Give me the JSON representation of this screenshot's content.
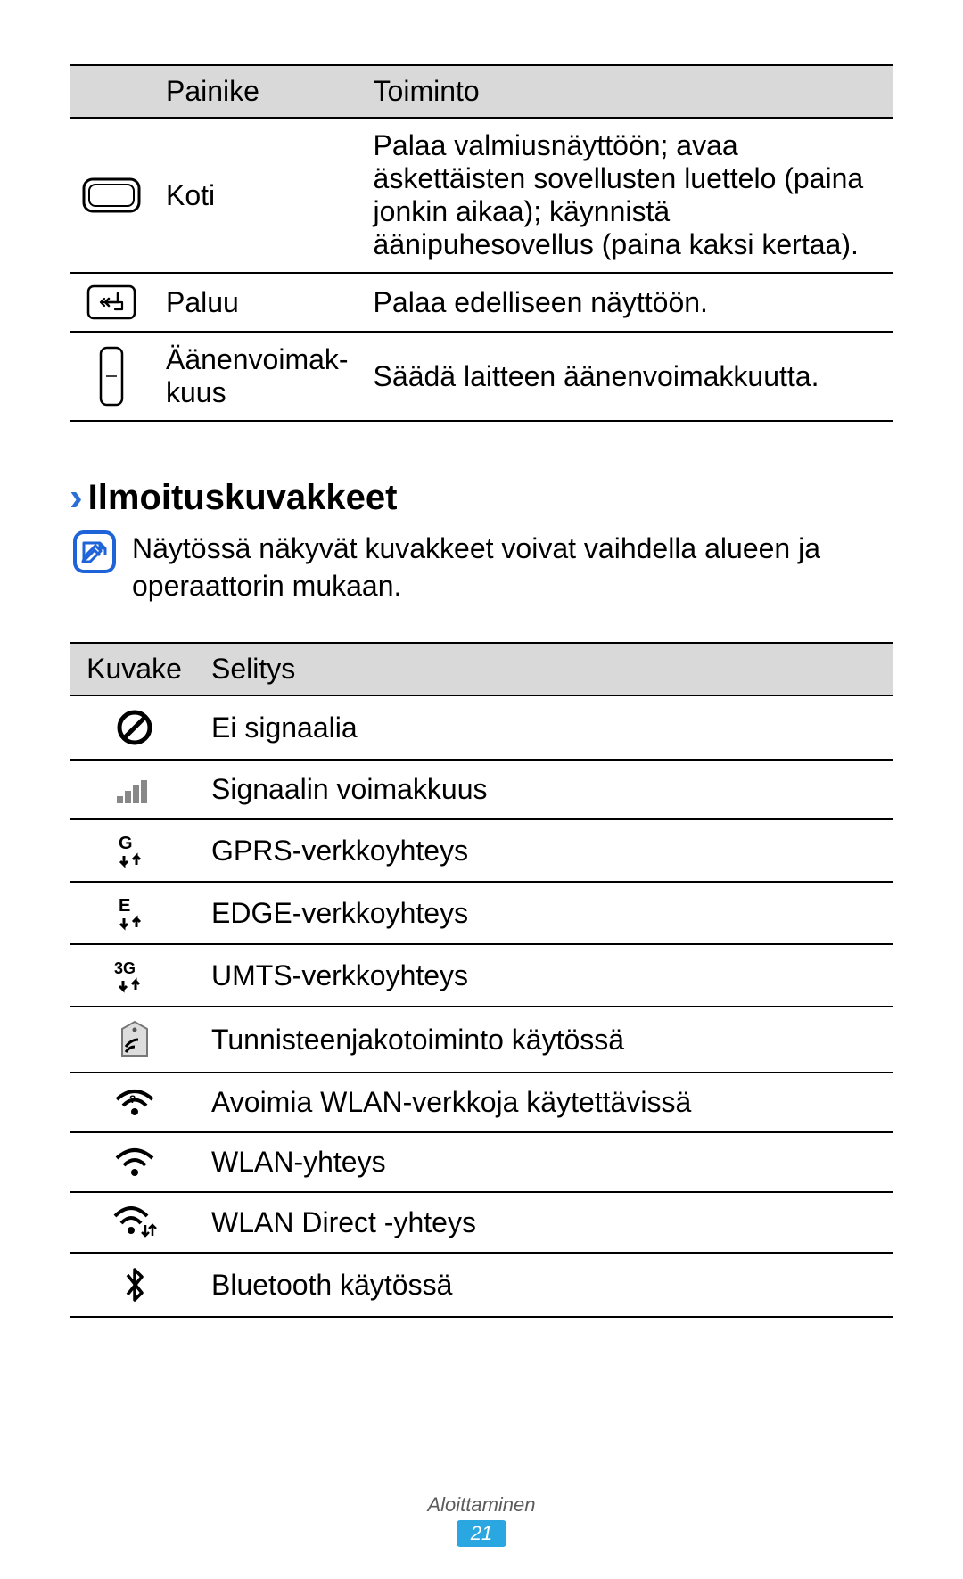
{
  "table1": {
    "headers": {
      "button": "Painike",
      "function": "Toiminto"
    },
    "rows": [
      {
        "name": "Koti",
        "func": "Palaa valmiusnäyttöön; avaa äskettäisten sovellusten luettelo (paina jonkin aikaa); käynnistä äänipuhesovellus (paina kaksi kertaa)."
      },
      {
        "name": "Paluu",
        "func": "Palaa edelliseen näyttöön."
      },
      {
        "name": "Äänenvoimak-kuus",
        "func": "Säädä laitteen äänenvoimakkuutta."
      }
    ]
  },
  "section": {
    "title": "Ilmoituskuvakkeet",
    "note": "Näytössä näkyvät kuvakkeet voivat vaihdella alueen ja operaattorin mukaan."
  },
  "table2": {
    "headers": {
      "icon": "Kuvake",
      "desc": "Selitys"
    },
    "rows": [
      {
        "desc": "Ei signaalia"
      },
      {
        "desc": "Signaalin voimakkuus"
      },
      {
        "desc": "GPRS-verkkoyhteys"
      },
      {
        "desc": "EDGE-verkkoyhteys"
      },
      {
        "desc": "UMTS-verkkoyhteys"
      },
      {
        "desc": "Tunnisteenjakotoiminto käytössä"
      },
      {
        "desc": "Avoimia WLAN-verkkoja käytettävissä"
      },
      {
        "desc": "WLAN-yhteys"
      },
      {
        "desc": "WLAN Direct -yhteys"
      },
      {
        "desc": "Bluetooth käytössä"
      }
    ]
  },
  "footer": {
    "section": "Aloittaminen",
    "page": "21"
  }
}
